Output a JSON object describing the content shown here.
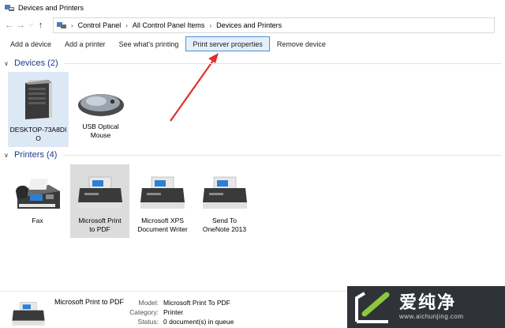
{
  "window": {
    "title": "Devices and Printers"
  },
  "address": {
    "crumbs": [
      "Control Panel",
      "All Control Panel Items",
      "Devices and Printers"
    ]
  },
  "toolbar": {
    "add_device": "Add a device",
    "add_printer": "Add a printer",
    "see_printing": "See what's printing",
    "print_server": "Print server properties",
    "remove_device": "Remove device"
  },
  "groups": {
    "devices": {
      "title": "Devices (2)",
      "items": [
        {
          "label_line1": "DESKTOP-73A8DI",
          "label_line2": "O",
          "icon": "computer-tower-icon"
        },
        {
          "label_line1": "USB Optical",
          "label_line2": "Mouse",
          "icon": "mouse-icon"
        }
      ]
    },
    "printers": {
      "title": "Printers (4)",
      "items": [
        {
          "label_line1": "Fax",
          "label_line2": "",
          "icon": "fax-icon"
        },
        {
          "label_line1": "Microsoft Print",
          "label_line2": "to PDF",
          "icon": "printer-icon"
        },
        {
          "label_line1": "Microsoft XPS",
          "label_line2": "Document Writer",
          "icon": "printer-icon"
        },
        {
          "label_line1": "Send To",
          "label_line2": "OneNote 2013",
          "icon": "printer-icon"
        }
      ]
    }
  },
  "details": {
    "name": "Microsoft Print to PDF",
    "model_label": "Model:",
    "model_value": "Microsoft Print To PDF",
    "category_label": "Category:",
    "category_value": "Printer",
    "status_label": "Status:",
    "status_value": "0 document(s) in queue"
  },
  "watermark": {
    "chinese": "爱纯净",
    "url": "www.aichunjing.com"
  },
  "colors": {
    "accent": "#4a8fd4",
    "arrow": "#e03030",
    "group_title": "#1e3a8a"
  }
}
